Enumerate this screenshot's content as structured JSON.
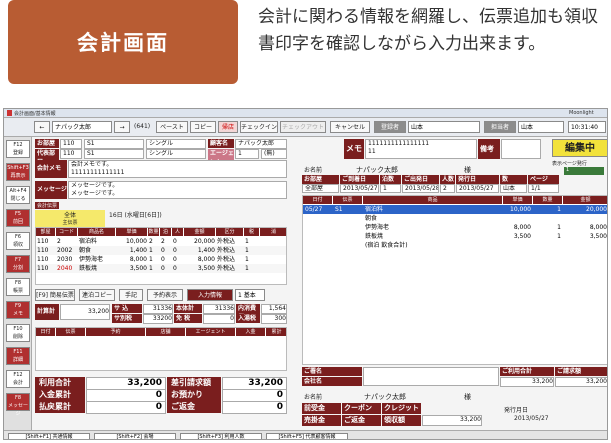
{
  "header": {
    "label": "会計画面",
    "description": "会計に関わる情報を網羅し、伝票追加も領収書印字を確認しながら入力出来ます。"
  },
  "window": {
    "title": "会計画面/基本情報",
    "right_title": "Moonlight"
  },
  "toolbar": {
    "prev": "←",
    "customer": "ナパック太郎",
    "next": "→",
    "count": "(641)",
    "paste": "ペースト",
    "copy": "コピー",
    "cancel_out": "帰店",
    "checkin": "チェックイン",
    "checkout": "チェックアウト",
    "cancel": "キャンセル",
    "reg_label": "登録者",
    "reg_value": "山本",
    "staff_label": "担当者",
    "staff_value": "山本",
    "date": "10:31:40"
  },
  "fkeys": [
    {
      "k": "F12",
      "l": "登録"
    },
    {
      "k": "Shift+F3",
      "l": "再表示"
    },
    {
      "k": "Alt+F4",
      "l": "閉じる"
    },
    {
      "k": "F5",
      "l": "前回"
    },
    {
      "k": "F6",
      "l": "領収"
    },
    {
      "k": "F7",
      "l": "分割"
    },
    {
      "k": "F8",
      "l": "帳票"
    },
    {
      "k": "F9",
      "l": "メモ"
    },
    {
      "k": "F10",
      "l": "削除"
    },
    {
      "k": "F11",
      "l": "詳細"
    },
    {
      "k": "F12",
      "l": "会計"
    },
    {
      "k": "F8",
      "l": "メッセージ"
    }
  ],
  "left": {
    "dept_label": "お部屋",
    "dept_v1": "110",
    "dept_v2": "S1",
    "dept_type": "シングル",
    "guest_label": "顧客名",
    "guest_name": "ナパック太郎",
    "rep_label": "代表部屋",
    "rep_v1": "110",
    "rep_v2": "S1",
    "rep_type": "シングル",
    "agent_label": "エージェント",
    "agent_v": "1",
    "agent_name": "(無)",
    "memo_label": "会計メモ",
    "memo_line1": "会計メモです。",
    "memo_line2": "11111111111111",
    "msg_label": "メッセージ",
    "msg_line1": "メッセージです。",
    "msg_line2": "メッセージです。",
    "tab1": "全体",
    "tab2": "主伝票",
    "date_text": "16日 (水曜日[6日])",
    "grid_headers": [
      "部屋",
      "コード",
      "商品名",
      "単価",
      "数量",
      "泊",
      "人",
      "金額",
      "区分",
      "税",
      "消"
    ],
    "rows": [
      {
        "room": "110",
        "code": "2",
        "name": "宿泊料",
        "price": "10,000",
        "qty": "2",
        "night": "2",
        "ppl": "0",
        "amt": "20,000",
        "kbn": "外税込",
        "tax": "1"
      },
      {
        "room": "110",
        "code": "2002",
        "name": "朝食",
        "price": "1,400",
        "qty": "1",
        "night": "0",
        "ppl": "0",
        "amt": "1,400",
        "kbn": "外税込",
        "tax": "1"
      },
      {
        "room": "110",
        "code": "2030",
        "name": "伊勢海老",
        "price": "8,000",
        "qty": "1",
        "night": "0",
        "ppl": "0",
        "amt": "8,000",
        "kbn": "外税込",
        "tax": "1"
      },
      {
        "room": "110",
        "code": "2040",
        "name": "鉄板焼",
        "price": "3,500",
        "qty": "1",
        "night": "0",
        "ppl": "0",
        "amt": "3,500",
        "kbn": "外税込",
        "tax": "1"
      }
    ],
    "btn_simple": "[F9] 簡易伝票",
    "btn_copy": "連泊コピー",
    "btn_hand": "手記",
    "btn_reserve": "予約表示",
    "btn_info": "入力情報",
    "btn_basic": "1 基本",
    "sum_label": "計算計",
    "sum_value": "33,200",
    "svc_label": "サ 込",
    "svc_value": "31336",
    "tax_label": "本体計",
    "tax_value": "31336",
    "incl_label": "内消費税",
    "incl_value": "1,564",
    "svc2_label": "サ別税",
    "svc2_value": "33200",
    "bal_label": "免 税",
    "bal_value": "0",
    "deposit_label": "入湯税",
    "deposit_value": "300",
    "low_headers": [
      "日付",
      "伝票",
      "予約",
      "店舗",
      "エージェント",
      "入金",
      "累計"
    ],
    "totals": [
      {
        "l": "利用合計",
        "v": "33,200",
        "l2": "差引請求額",
        "v2": "33,200"
      },
      {
        "l": "入金累計",
        "v": "0",
        "l2": "お預かり",
        "v2": "0"
      },
      {
        "l": "払戻累計",
        "v": "0",
        "l2": "ご返金",
        "v2": "0"
      }
    ]
  },
  "right": {
    "memo_label": "メモ",
    "memo_text": "1111111111111111",
    "memo_text2": "11",
    "remark_label": "備考",
    "book_button": "編集中",
    "name_label": "お名前",
    "name_value": "ナパック太郎",
    "sama": "様",
    "preview": "表示ページ発行",
    "cnt": "1",
    "info_headers": [
      "お部屋",
      "ご到着日",
      "泊数",
      "ご出発日",
      "人数",
      "発行日",
      "数",
      "ページ"
    ],
    "info_values": [
      "全部屋",
      "2013/05/27",
      "1",
      "2013/05/28",
      "2",
      "2013/05/27",
      "山本",
      "1/1"
    ],
    "detail_headers": [
      "日付",
      "伝票",
      "商品",
      "単価",
      "数量",
      "金額"
    ],
    "detail_rows": [
      {
        "date": "05/27",
        "code": "S1",
        "name": "宿泊料",
        "price": "10,000",
        "qty": "1",
        "amt": "20,000"
      },
      {
        "date": "",
        "code": "",
        "name": "朝食",
        "price": "",
        "qty": "",
        "amt": ""
      },
      {
        "date": "",
        "code": "",
        "name": "伊勢海老",
        "price": "8,000",
        "qty": "1",
        "amt": "8,000"
      },
      {
        "date": "",
        "code": "",
        "name": "鉄板焼",
        "price": "3,500",
        "qty": "1",
        "amt": "3,500"
      },
      {
        "date": "",
        "code": "",
        "name": "(宿泊 飲食合計)",
        "price": "",
        "qty": "",
        "amt": ""
      }
    ],
    "company_label": "ご署名",
    "corp_label": "会社名",
    "use_total_label": "ご利用合計",
    "claim_label": "ご請求額",
    "use_total": "33,200",
    "claim": "33,200",
    "receipt_name": "ナパック太郎",
    "receipt_sama": "様",
    "receipt_headers": [
      "前受金",
      "クーポン",
      "クレジット"
    ],
    "receipt_headers2": [
      "売掛金",
      "ご返金",
      "領収額"
    ],
    "receipt_value": "33,200",
    "issue_label": "発行月日",
    "issue_date": "2013/05/27"
  },
  "bottom": [
    "[Shift+F1] 共通情報",
    "[Shift+F2] 会場",
    "[Shift+F3] 利用人数",
    "[Shift+F5] 代表顧客情報"
  ]
}
